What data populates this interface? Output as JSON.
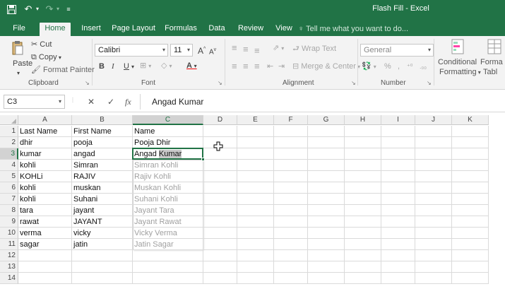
{
  "app": {
    "title": "Flash Fill - Excel"
  },
  "quick_access": {
    "save_icon": "save-icon",
    "undo_icon": "undo-icon",
    "redo_icon": "redo-icon",
    "customize_icon": "customize-icon"
  },
  "tabs": [
    {
      "label": "File"
    },
    {
      "label": "Home"
    },
    {
      "label": "Insert"
    },
    {
      "label": "Page Layout"
    },
    {
      "label": "Formulas"
    },
    {
      "label": "Data"
    },
    {
      "label": "Review"
    },
    {
      "label": "View"
    }
  ],
  "active_tab": "Home",
  "tell_me": {
    "placeholder": "Tell me what you want to do..."
  },
  "ribbon": {
    "clipboard": {
      "paste": "Paste",
      "cut": "Cut",
      "copy": "Copy",
      "format_painter": "Format Painter",
      "label": "Clipboard"
    },
    "font": {
      "name": "Calibri",
      "size": "11",
      "grow": "A",
      "shrink": "A",
      "bold": "B",
      "italic": "I",
      "underline": "U",
      "label": "Font"
    },
    "alignment": {
      "wrap_text": "Wrap Text",
      "merge_center": "Merge & Center",
      "label": "Alignment"
    },
    "number": {
      "format": "General",
      "percent": "%",
      "comma": ",",
      "label": "Number"
    },
    "styles": {
      "conditional_line1": "Conditional",
      "conditional_line2": "Formatting",
      "format_as_line1": "Forma",
      "format_as_line2": "Tabl"
    }
  },
  "formula_bar": {
    "name_box": "C3",
    "fx": "fx",
    "value": "Angad Kumar"
  },
  "columns": [
    "A",
    "B",
    "C",
    "D",
    "E",
    "F",
    "G",
    "H",
    "I",
    "J",
    "K"
  ],
  "selected_column": "C",
  "selected_row": 3,
  "rows": [
    {
      "n": "1",
      "a": "Last Name",
      "b": "First Name",
      "c": "Name",
      "ghost": false
    },
    {
      "n": "2",
      "a": "dhir",
      "b": "pooja",
      "c": "Pooja Dhir",
      "ghost": false
    },
    {
      "n": "3",
      "a": "kumar",
      "b": "angad",
      "c": "Angad Kumar",
      "ghost": false
    },
    {
      "n": "4",
      "a": "kohli",
      "b": "Simran",
      "c": "Simran Kohli",
      "ghost": true
    },
    {
      "n": "5",
      "a": "KOHLi",
      "b": "RAJIV",
      "c": "Rajiv Kohli",
      "ghost": true
    },
    {
      "n": "6",
      "a": "kohli",
      "b": "muskan",
      "c": "Muskan Kohli",
      "ghost": true
    },
    {
      "n": "7",
      "a": "kohli",
      "b": "Suhani",
      "c": "Suhani Kohli",
      "ghost": true
    },
    {
      "n": "8",
      "a": "tara",
      "b": "jayant",
      "c": "Jayant Tara",
      "ghost": true
    },
    {
      "n": "9",
      "a": "rawat",
      "b": "JAYANT",
      "c": "Jayant Rawat",
      "ghost": true
    },
    {
      "n": "10",
      "a": "verma",
      "b": "vicky",
      "c": "Vicky Verma",
      "ghost": true
    },
    {
      "n": "11",
      "a": "sagar",
      "b": "jatin",
      "c": "Jatin Sagar",
      "ghost": true
    },
    {
      "n": "12",
      "a": "",
      "b": "",
      "c": "",
      "ghost": false
    },
    {
      "n": "13",
      "a": "",
      "b": "",
      "c": "",
      "ghost": false
    },
    {
      "n": "14",
      "a": "",
      "b": "",
      "c": "",
      "ghost": false
    }
  ],
  "colors": {
    "accent": "#217346",
    "ghost_text": "#a0a0a0"
  }
}
